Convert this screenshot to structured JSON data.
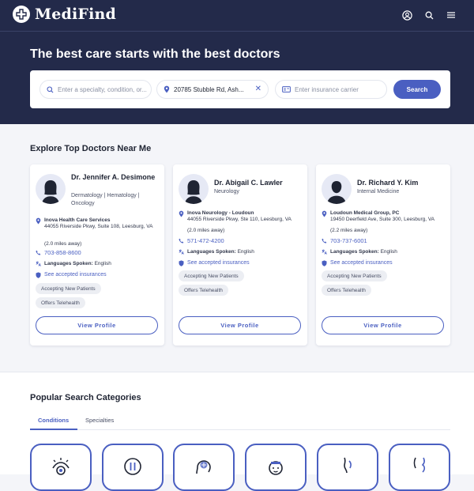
{
  "header": {
    "brand": "MediFind",
    "icons": [
      "user-icon",
      "search-icon",
      "menu-icon"
    ]
  },
  "hero": {
    "title": "The best care starts with the best doctors",
    "search": {
      "specialty_placeholder": "Enter a specialty, condition, or...",
      "location_value": "20785 Stubble Rd, Ash...",
      "insurance_placeholder": "Enter insurance carrier",
      "button_label": "Search"
    }
  },
  "explore": {
    "title": "Explore Top Doctors Near Me",
    "doctors": [
      {
        "name": "Dr. Jennifer A. Desimone",
        "specialty": "Dermatology | Hematology | Oncology",
        "practice": "Inova Health Care Services",
        "address": "44055 Riverside Pkwy, Suite 108, Leesburg, VA",
        "distance": "(2.0 miles away)",
        "phone": "703-858-8600",
        "languages_label": "Languages Spoken:",
        "languages": "English",
        "insurance_link": "See accepted insurances",
        "tags": [
          "Accepting New Patients",
          "Offers Telehealth"
        ],
        "button": "View Profile"
      },
      {
        "name": "Dr. Abigail C. Lawler",
        "specialty": "Neurology",
        "practice": "Inova Neurology - Loudoun",
        "address": "44055 Riverside Pkwy, Ste 110, Leesburg, VA",
        "distance": "(2.0 miles away)",
        "phone": "571-472-4200",
        "languages_label": "Languages Spoken:",
        "languages": "English",
        "insurance_link": "See accepted insurances",
        "tags": [
          "Accepting New Patients",
          "Offers Telehealth"
        ],
        "button": "View Profile"
      },
      {
        "name": "Dr. Richard Y. Kim",
        "specialty": "Internal Medicine",
        "practice": "Loudoun Medical Group, PC",
        "address": "19450 Deerfield Ave, Suite 300, Leesburg, VA",
        "distance": "(2.2 miles away)",
        "phone": "703-737-6001",
        "languages_label": "Languages Spoken:",
        "languages": "English",
        "insurance_link": "See accepted insurances",
        "tags": [
          "Accepting New Patients",
          "Offers Telehealth"
        ],
        "button": "View Profile"
      }
    ]
  },
  "popular": {
    "title": "Popular Search Categories",
    "tabs": [
      {
        "label": "Conditions",
        "active": true
      },
      {
        "label": "Specialties",
        "active": false
      }
    ],
    "category_icons": [
      "eye-icon",
      "pause-icon",
      "brain-icon",
      "baby-icon",
      "body-icon",
      "pregnancy-icon"
    ]
  },
  "colors": {
    "navy": "#232a4a",
    "accent": "#4a5fc1",
    "background": "#f4f5f9"
  }
}
